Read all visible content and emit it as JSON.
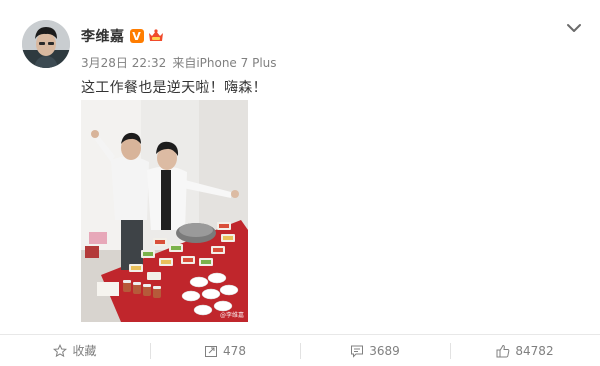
{
  "post": {
    "username": "李维嘉",
    "verified_badge": "V",
    "date": "3月28日 22:32",
    "source": "来自iPhone 7 Plus",
    "text": "这工作餐也是逆天啦！嗨森！",
    "photo_watermark": "@李维嘉"
  },
  "actions": {
    "favorite_label": "收藏",
    "repost_count": "478",
    "comment_count": "3689",
    "like_count": "84782"
  },
  "colors": {
    "verified": "#ff7d00",
    "meta_text": "#808080",
    "body_text": "#333333",
    "border": "#e8e8e8"
  },
  "icons": [
    "favorite-star-icon",
    "repost-icon",
    "comment-icon",
    "like-thumb-icon",
    "chevron-down-icon"
  ]
}
